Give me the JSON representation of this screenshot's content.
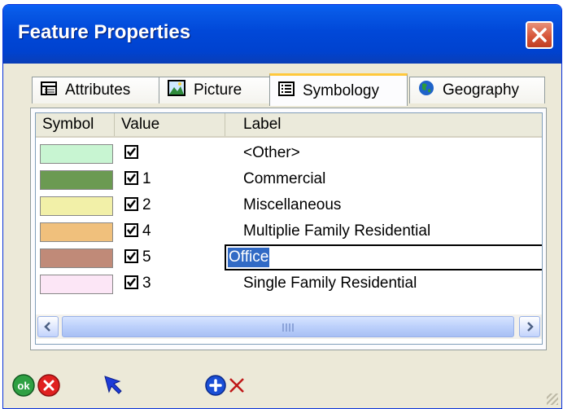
{
  "window": {
    "title": "Feature Properties"
  },
  "tabs": [
    {
      "label": "Attributes",
      "icon": "table-icon"
    },
    {
      "label": "Picture",
      "icon": "picture-icon"
    },
    {
      "label": "Symbology",
      "icon": "list-icon",
      "active": true
    },
    {
      "label": "Geography",
      "icon": "globe-icon"
    }
  ],
  "grid": {
    "columns": [
      "Symbol",
      "Value",
      "Label"
    ],
    "rows": [
      {
        "color": "#c8f5d2",
        "checked": true,
        "value": "",
        "label": "<Other>"
      },
      {
        "color": "#6b9a52",
        "checked": true,
        "value": "1",
        "label": "Commercial"
      },
      {
        "color": "#f2f0a8",
        "checked": true,
        "value": "2",
        "label": "Miscellaneous"
      },
      {
        "color": "#f0c07c",
        "checked": true,
        "value": "4",
        "label": "Multiplie Family Residential"
      },
      {
        "color": "#c08a78",
        "checked": true,
        "value": "5",
        "label": "Office",
        "editing": true
      },
      {
        "color": "#fce6f6",
        "checked": true,
        "value": "3",
        "label": "Single Family Residential"
      }
    ]
  },
  "toolbar": {
    "ok_label": "ok",
    "icons": [
      "ok-icon",
      "cancel-icon",
      "pointer-icon",
      "add-icon",
      "delete-icon"
    ]
  }
}
